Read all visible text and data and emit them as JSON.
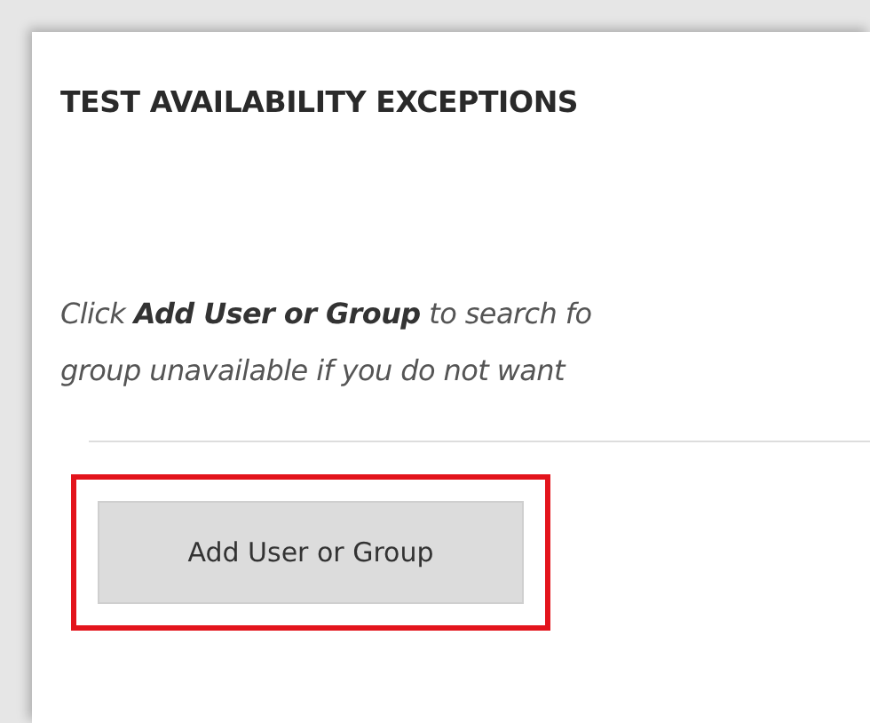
{
  "panel": {
    "title": "TEST AVAILABILITY EXCEPTIONS",
    "instruction_lines": [
      "Click **Add User or Group** to search fo",
      "group unavailable if you do not want"
    ],
    "button": {
      "label": "Add User or Group",
      "highlighted": true
    }
  }
}
